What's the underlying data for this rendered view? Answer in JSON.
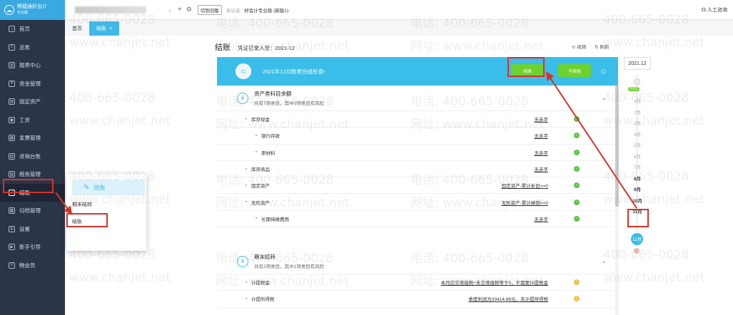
{
  "sidebar": {
    "brand_name": "畅捷通好会计",
    "brand_sub": "专业版",
    "items": [
      {
        "label": "首页",
        "icon": "home-icon",
        "glyph": "⌂"
      },
      {
        "label": "总账",
        "icon": "ledger-icon",
        "glyph": "≡"
      },
      {
        "label": "报表中心",
        "icon": "report-icon",
        "glyph": "▥"
      },
      {
        "label": "资金管理",
        "icon": "fund-icon",
        "glyph": "¥"
      },
      {
        "label": "固定资产",
        "icon": "asset-icon",
        "glyph": "▤"
      },
      {
        "label": "工资",
        "icon": "salary-icon",
        "glyph": "▣"
      },
      {
        "label": "发票管理",
        "icon": "invoice-icon",
        "glyph": "▦"
      },
      {
        "label": "进销台账",
        "icon": "inventory-icon",
        "glyph": "▧"
      },
      {
        "label": "税务管理",
        "icon": "tax-icon",
        "glyph": "▨"
      },
      {
        "label": "结账",
        "icon": "close-account-icon",
        "glyph": "✓"
      },
      {
        "label": "归档管理",
        "icon": "archive-icon",
        "glyph": "▩"
      },
      {
        "label": "设置",
        "icon": "settings-icon",
        "glyph": "⚙"
      },
      {
        "label": "新手引导",
        "icon": "guide-icon",
        "glyph": "▶"
      },
      {
        "label": "畅会员",
        "icon": "member-icon",
        "glyph": "V"
      }
    ]
  },
  "topbar": {
    "switch_old": "切到旧版",
    "cert": "未认证",
    "version": "好会计专业版 (新版1)",
    "service": "人工咨询"
  },
  "tabs": {
    "home": "首页",
    "active": "结账",
    "close_glyph": "×"
  },
  "page": {
    "title": "结账",
    "voucher_status": "凭证已录入至：2021-12",
    "link_video": "视频",
    "link_refresh": "刷新"
  },
  "banner": {
    "message": "2021年12月账表完成检查!",
    "btn_close": "结账",
    "btn_not_close": "不结账"
  },
  "section1": {
    "title": "资产类科目余额",
    "desc": "共有7项类目，其中0项类目有风险",
    "rows": [
      {
        "label": "库存现金",
        "detail": "无赤字",
        "sub": false
      },
      {
        "label": "银行存款",
        "detail": "无赤字",
        "sub": true
      },
      {
        "label": "原材料",
        "detail": "无赤字",
        "sub": true
      },
      {
        "label": "库存商品",
        "detail": "无赤字",
        "sub": false
      },
      {
        "label": "固定资产",
        "detail": "固定资产-累计折旧>=0",
        "sub": false
      },
      {
        "label": "无形资产",
        "detail": "无形资产-累计摊销>=0",
        "sub": false
      },
      {
        "label": "长期待摊费用",
        "detail": "无赤字",
        "sub": true
      }
    ]
  },
  "section2": {
    "title": "期末结转",
    "desc": "共有2项类目，其中1项类目有风险",
    "rows": [
      {
        "label": "计提税金",
        "detail": "本月应交增值税+未交增值税等于0，不需要计提税金",
        "sub": false
      },
      {
        "label": "计提所得税",
        "detail": "季度利润为33414.88元，未计提所得税",
        "sub": false
      }
    ]
  },
  "timeline": {
    "year": "2021.12",
    "badge": "2021",
    "months": [
      "1月",
      "2月",
      "3月",
      "4月",
      "5月",
      "6月",
      "7月",
      "8月",
      "9月",
      "10月",
      "11月"
    ],
    "current": "12月"
  },
  "popup": {
    "head": "结账",
    "item1": "期末结转",
    "item2": "结账"
  },
  "watermark": {
    "phone": "电话: 400-665-0028",
    "site": "网址: www.chanjet.net",
    "phone_short": "400-665-0028",
    "site_short": "www.chanjet.net"
  },
  "colors": {
    "sidebar_bg": "#2b3548",
    "accent": "#3bbde9",
    "button_green": "#6ed22e",
    "ok_green": "#5cc34a",
    "highlight_red": "#d5332a"
  }
}
